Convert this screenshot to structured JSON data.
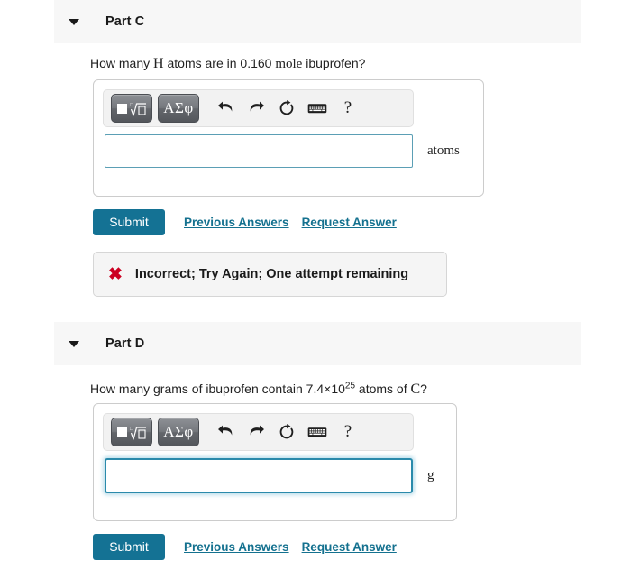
{
  "parts": [
    {
      "id": "part-c",
      "title": "Part C",
      "collapse_icon": "triangle-down-icon",
      "question": {
        "segment_1": "How many ",
        "math_1": "H",
        "segment_2": " atoms are in 0.160 ",
        "math_2": "mole",
        "segment_3": " ibuprofen?"
      },
      "toolbar": {
        "template_button_label": "math-template",
        "greek_button_label": "ΑΣφ",
        "undo_label": "undo",
        "redo_label": "redo",
        "reset_label": "reset",
        "keyboard_label": "keyboard",
        "help_label": "?"
      },
      "input": {
        "value": "",
        "placeholder": "",
        "focused": false
      },
      "unit": "atoms",
      "actions": {
        "submit_label": "Submit",
        "previous_answers_label": "Previous Answers",
        "request_answer_label": "Request Answer"
      },
      "feedback": {
        "icon": "red-x-icon",
        "icon_glyph": "✖",
        "text": "Incorrect; Try Again; One attempt remaining"
      }
    },
    {
      "id": "part-d",
      "title": "Part D",
      "collapse_icon": "triangle-down-icon",
      "question": {
        "segment_1": "How many grams of ibuprofen contain 7.4×10",
        "exponent": "25",
        "segment_2": " atoms of ",
        "math_1": "C",
        "segment_3": "?"
      },
      "toolbar": {
        "template_button_label": "math-template",
        "greek_button_label": "ΑΣφ",
        "undo_label": "undo",
        "redo_label": "redo",
        "reset_label": "reset",
        "keyboard_label": "keyboard",
        "help_label": "?"
      },
      "input": {
        "value": "",
        "placeholder": "",
        "focused": true
      },
      "unit": "g",
      "actions": {
        "submit_label": "Submit",
        "previous_answers_label": "Previous Answers",
        "request_answer_label": "Request Answer"
      }
    }
  ],
  "colors": {
    "header_band": "#f7f7f7",
    "submit_teal": "#147294",
    "link_teal": "#14718f",
    "input_border_idle": "#5b9fb5",
    "input_border_focus": "#2a8aab",
    "error_red": "#cc0022"
  }
}
